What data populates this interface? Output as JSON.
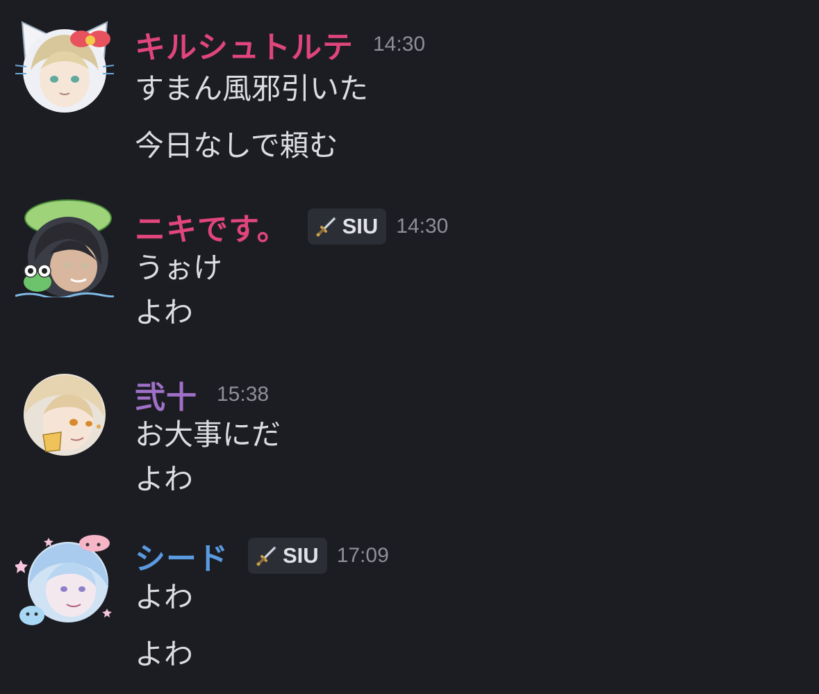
{
  "messages": [
    {
      "username": "キルシュトルテ",
      "username_color": "#e0457b",
      "timestamp": "14:30",
      "tag": null,
      "lines": [
        "すまん風邪引いた",
        "今日なしで頼む"
      ]
    },
    {
      "username": "ニキです。",
      "username_color": "#e0457b",
      "timestamp": "14:30",
      "tag": "SIU",
      "lines": [
        "うぉけ",
        "よわ"
      ]
    },
    {
      "username": "弐十",
      "username_color": "#a070c8",
      "timestamp": "15:38",
      "tag": null,
      "lines": [
        "お大事にだ",
        "よわ"
      ]
    },
    {
      "username": "シード",
      "username_color": "#5a9ae0",
      "timestamp": "17:09",
      "tag": "SIU",
      "lines": [
        "よわ",
        "よわ"
      ]
    }
  ]
}
